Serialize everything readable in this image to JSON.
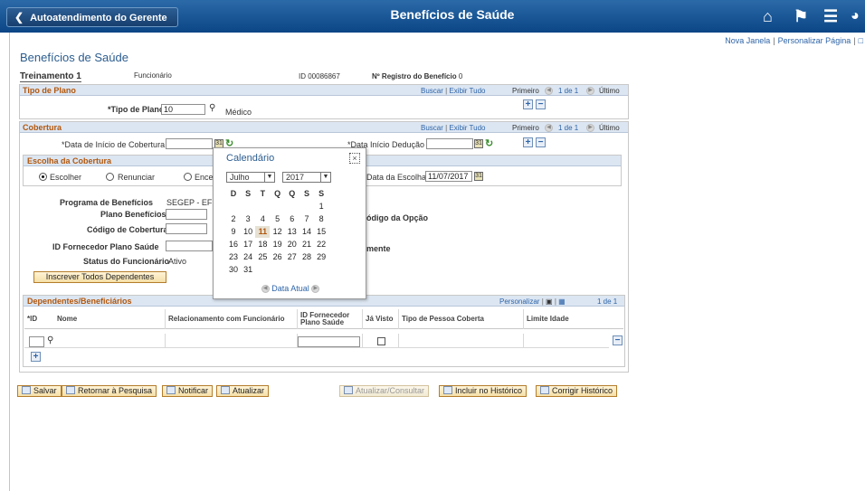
{
  "topbar": {
    "back_label": "Autoatendimento do Gerente",
    "title": "Benefícios de Saúde"
  },
  "toplinks": {
    "new_window": "Nova Janela",
    "personalize": "Personalizar Página"
  },
  "page_title": "Benefícios de Saúde",
  "header": {
    "employee": "Treinamento 1",
    "role": "Funcionário",
    "id_label": "ID",
    "id_value": "00086867",
    "reg_label": "Nº Registro do Benefício",
    "reg_value": "0"
  },
  "plan_type": {
    "section": "Tipo de Plano",
    "search": "Buscar",
    "show_all": "Exibir Tudo",
    "first": "Primeiro",
    "count": "1 de 1",
    "last": "Último",
    "field_label": "*Tipo de Plano",
    "field_value": "10",
    "field_desc": "Médico"
  },
  "coverage": {
    "section": "Cobertura",
    "search": "Buscar",
    "show_all": "Exibir Tudo",
    "first": "Primeiro",
    "count": "1 de 1",
    "last": "Último",
    "start_label": "*Data de Início de Cobertura",
    "deduction_label": "*Data Início Dedução",
    "choice_section": "Escolha da Cobertura",
    "opt_choose": "Escolher",
    "opt_decline": "Renunciar",
    "opt_end": "Ence",
    "choice_date_label": "Data da Escolha",
    "choice_date_value": "11/07/2017",
    "program_label": "Programa de Benefícios",
    "program_value": "SEGEP - EF",
    "plan_label": "Plano Benefícios",
    "option_code_label": "ódigo da Opção",
    "coverage_code_label": "Código de Cobertura",
    "provider_label": "ID Fornecedor Plano Saúde",
    "suffix_mente": "mente",
    "status_label": "Status do Funcionário",
    "status_value": "Ativo",
    "enroll_all": "Inscrever Todos Dependentes"
  },
  "dependents": {
    "section": "Dependentes/Beneficiários",
    "personalize": "Personalizar",
    "count": "1 de 1",
    "columns": [
      "*ID",
      "Nome",
      "Relacionamento com Funcionário",
      "ID Fornecedor Plano Saúde",
      "Já Visto",
      "Tipo de Pessoa Coberta",
      "Limite Idade"
    ]
  },
  "footer": {
    "save": "Salvar",
    "return": "Retornar à Pesquisa",
    "notify": "Notificar",
    "refresh": "Atualizar",
    "update_view": "Atualizar/Consultar",
    "include_history": "Incluir no Histórico",
    "correct_history": "Corrigir Histórico"
  },
  "calendar": {
    "title": "Calendário",
    "month": "Julho",
    "year": "2017",
    "weekdays": [
      "D",
      "S",
      "T",
      "Q",
      "Q",
      "S",
      "S"
    ],
    "days": [
      "1",
      "2",
      "3",
      "4",
      "5",
      "6",
      "7",
      "8",
      "9",
      "10",
      "11",
      "12",
      "13",
      "14",
      "15",
      "16",
      "17",
      "18",
      "19",
      "20",
      "21",
      "22",
      "23",
      "24",
      "25",
      "26",
      "27",
      "28",
      "29",
      "30",
      "31"
    ],
    "today": "11",
    "current_date": "Data Atual"
  }
}
